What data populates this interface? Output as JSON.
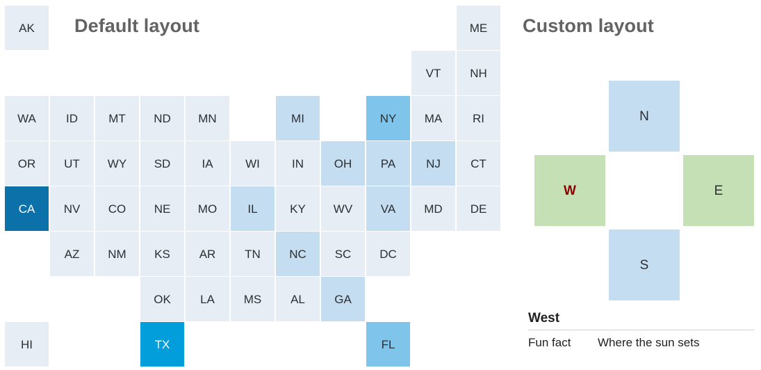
{
  "page": {
    "background": "#ffffff"
  },
  "palette": {
    "tile_base": "#e6edf5",
    "step_1": "#dde8f3",
    "step_2": "#d2e3f2",
    "step_3": "#c5ddf1",
    "step_4": "#aed4ef",
    "step_5": "#7fc4ea",
    "step_6": "#029ddb",
    "step_7": "#0c71a8",
    "green": "#c5e0b4",
    "label_dark": "#2b2f33",
    "label_light": "#ffffff",
    "emphasis_text": "#8b0000",
    "title_text": "#636363"
  },
  "default_panel": {
    "title": "Default layout",
    "columns": 11,
    "rows": 8,
    "tiles": [
      {
        "label": "AK",
        "col": 0,
        "row": 0,
        "color": "#e6edf5",
        "text": "#2b2f33"
      },
      {
        "label": "ME",
        "col": 10,
        "row": 0,
        "color": "#e6edf5",
        "text": "#2b2f33"
      },
      {
        "label": "VT",
        "col": 9,
        "row": 1,
        "color": "#e6edf5",
        "text": "#2b2f33"
      },
      {
        "label": "NH",
        "col": 10,
        "row": 1,
        "color": "#e6edf5",
        "text": "#2b2f33"
      },
      {
        "label": "WA",
        "col": 0,
        "row": 2,
        "color": "#e6edf5",
        "text": "#2b2f33"
      },
      {
        "label": "ID",
        "col": 1,
        "row": 2,
        "color": "#e6edf5",
        "text": "#2b2f33"
      },
      {
        "label": "MT",
        "col": 2,
        "row": 2,
        "color": "#e6edf5",
        "text": "#2b2f33"
      },
      {
        "label": "ND",
        "col": 3,
        "row": 2,
        "color": "#e6edf5",
        "text": "#2b2f33"
      },
      {
        "label": "MN",
        "col": 4,
        "row": 2,
        "color": "#e6edf5",
        "text": "#2b2f33"
      },
      {
        "label": "MI",
        "col": 6,
        "row": 2,
        "color": "#c5ddf1",
        "text": "#2b2f33"
      },
      {
        "label": "NY",
        "col": 8,
        "row": 2,
        "color": "#7fc4ea",
        "text": "#2b2f33"
      },
      {
        "label": "MA",
        "col": 9,
        "row": 2,
        "color": "#e6edf5",
        "text": "#2b2f33"
      },
      {
        "label": "RI",
        "col": 10,
        "row": 2,
        "color": "#e6edf5",
        "text": "#2b2f33"
      },
      {
        "label": "OR",
        "col": 0,
        "row": 3,
        "color": "#e6edf5",
        "text": "#2b2f33"
      },
      {
        "label": "UT",
        "col": 1,
        "row": 3,
        "color": "#e6edf5",
        "text": "#2b2f33"
      },
      {
        "label": "WY",
        "col": 2,
        "row": 3,
        "color": "#e6edf5",
        "text": "#2b2f33"
      },
      {
        "label": "SD",
        "col": 3,
        "row": 3,
        "color": "#e6edf5",
        "text": "#2b2f33"
      },
      {
        "label": "IA",
        "col": 4,
        "row": 3,
        "color": "#e6edf5",
        "text": "#2b2f33"
      },
      {
        "label": "WI",
        "col": 5,
        "row": 3,
        "color": "#e6edf5",
        "text": "#2b2f33"
      },
      {
        "label": "IN",
        "col": 6,
        "row": 3,
        "color": "#e6edf5",
        "text": "#2b2f33"
      },
      {
        "label": "OH",
        "col": 7,
        "row": 3,
        "color": "#c5ddf1",
        "text": "#2b2f33"
      },
      {
        "label": "PA",
        "col": 8,
        "row": 3,
        "color": "#c5ddf1",
        "text": "#2b2f33"
      },
      {
        "label": "NJ",
        "col": 9,
        "row": 3,
        "color": "#c5ddf1",
        "text": "#2b2f33"
      },
      {
        "label": "CT",
        "col": 10,
        "row": 3,
        "color": "#e6edf5",
        "text": "#2b2f33"
      },
      {
        "label": "CA",
        "col": 0,
        "row": 4,
        "color": "#0c71a8",
        "text": "#ffffff"
      },
      {
        "label": "NV",
        "col": 1,
        "row": 4,
        "color": "#e6edf5",
        "text": "#2b2f33"
      },
      {
        "label": "CO",
        "col": 2,
        "row": 4,
        "color": "#e6edf5",
        "text": "#2b2f33"
      },
      {
        "label": "NE",
        "col": 3,
        "row": 4,
        "color": "#e6edf5",
        "text": "#2b2f33"
      },
      {
        "label": "MO",
        "col": 4,
        "row": 4,
        "color": "#e6edf5",
        "text": "#2b2f33"
      },
      {
        "label": "IL",
        "col": 5,
        "row": 4,
        "color": "#c5ddf1",
        "text": "#2b2f33"
      },
      {
        "label": "KY",
        "col": 6,
        "row": 4,
        "color": "#e6edf5",
        "text": "#2b2f33"
      },
      {
        "label": "WV",
        "col": 7,
        "row": 4,
        "color": "#e6edf5",
        "text": "#2b2f33"
      },
      {
        "label": "VA",
        "col": 8,
        "row": 4,
        "color": "#c5ddf1",
        "text": "#2b2f33"
      },
      {
        "label": "MD",
        "col": 9,
        "row": 4,
        "color": "#e6edf5",
        "text": "#2b2f33"
      },
      {
        "label": "DE",
        "col": 10,
        "row": 4,
        "color": "#e6edf5",
        "text": "#2b2f33"
      },
      {
        "label": "AZ",
        "col": 1,
        "row": 5,
        "color": "#e6edf5",
        "text": "#2b2f33"
      },
      {
        "label": "NM",
        "col": 2,
        "row": 5,
        "color": "#e6edf5",
        "text": "#2b2f33"
      },
      {
        "label": "KS",
        "col": 3,
        "row": 5,
        "color": "#e6edf5",
        "text": "#2b2f33"
      },
      {
        "label": "AR",
        "col": 4,
        "row": 5,
        "color": "#e6edf5",
        "text": "#2b2f33"
      },
      {
        "label": "TN",
        "col": 5,
        "row": 5,
        "color": "#e6edf5",
        "text": "#2b2f33"
      },
      {
        "label": "NC",
        "col": 6,
        "row": 5,
        "color": "#c5ddf1",
        "text": "#2b2f33"
      },
      {
        "label": "SC",
        "col": 7,
        "row": 5,
        "color": "#e6edf5",
        "text": "#2b2f33"
      },
      {
        "label": "DC",
        "col": 8,
        "row": 5,
        "color": "#e6edf5",
        "text": "#2b2f33"
      },
      {
        "label": "OK",
        "col": 3,
        "row": 6,
        "color": "#e6edf5",
        "text": "#2b2f33"
      },
      {
        "label": "LA",
        "col": 4,
        "row": 6,
        "color": "#e6edf5",
        "text": "#2b2f33"
      },
      {
        "label": "MS",
        "col": 5,
        "row": 6,
        "color": "#e6edf5",
        "text": "#2b2f33"
      },
      {
        "label": "AL",
        "col": 6,
        "row": 6,
        "color": "#e6edf5",
        "text": "#2b2f33"
      },
      {
        "label": "GA",
        "col": 7,
        "row": 6,
        "color": "#c5ddf1",
        "text": "#2b2f33"
      },
      {
        "label": "HI",
        "col": 0,
        "row": 7,
        "color": "#e6edf5",
        "text": "#2b2f33"
      },
      {
        "label": "TX",
        "col": 3,
        "row": 7,
        "color": "#029ddb",
        "text": "#ffffff"
      },
      {
        "label": "FL",
        "col": 8,
        "row": 7,
        "color": "#7fc4ea",
        "text": "#2b2f33"
      }
    ]
  },
  "custom_panel": {
    "title": "Custom layout",
    "columns": 3,
    "rows": 3,
    "tiles": [
      {
        "label": "N",
        "col": 1,
        "row": 0,
        "color": "#c5ddf1",
        "text": "#2b2f33",
        "emphasis": false
      },
      {
        "label": "W",
        "col": 0,
        "row": 1,
        "color": "#c5e0b4",
        "text": "#8b0000",
        "emphasis": true
      },
      {
        "label": "E",
        "col": 2,
        "row": 1,
        "color": "#c5e0b4",
        "text": "#2b2f33",
        "emphasis": false
      },
      {
        "label": "S",
        "col": 1,
        "row": 2,
        "color": "#c5ddf1",
        "text": "#2b2f33",
        "emphasis": false
      }
    ]
  },
  "detail_panel": {
    "title": "West",
    "rows": [
      {
        "key": "Fun fact",
        "value": "Where the sun sets"
      }
    ]
  }
}
